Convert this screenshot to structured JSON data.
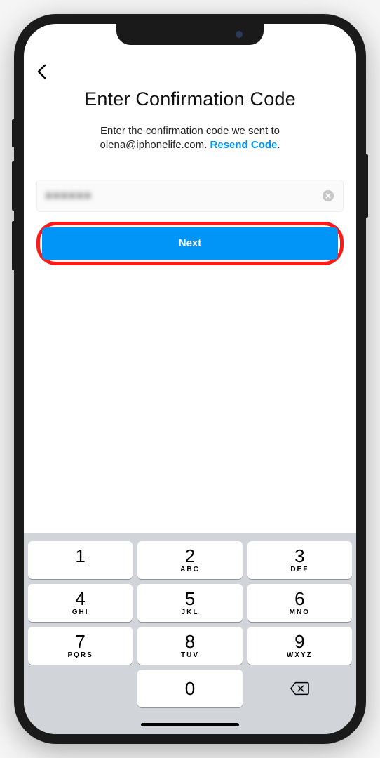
{
  "header": {
    "title": "Enter Confirmation Code",
    "subtitle_prefix": "Enter the confirmation code we sent to ",
    "email": "olena@iphonelife.com",
    "subtitle_separator": ". ",
    "resend_link": "Resend Code",
    "subtitle_suffix": "."
  },
  "form": {
    "code_value": "●●●●●●",
    "next_label": "Next"
  },
  "keyboard": {
    "keys": [
      {
        "digit": "1",
        "letters": ""
      },
      {
        "digit": "2",
        "letters": "ABC"
      },
      {
        "digit": "3",
        "letters": "DEF"
      },
      {
        "digit": "4",
        "letters": "GHI"
      },
      {
        "digit": "5",
        "letters": "JKL"
      },
      {
        "digit": "6",
        "letters": "MNO"
      },
      {
        "digit": "7",
        "letters": "PQRS"
      },
      {
        "digit": "8",
        "letters": "TUV"
      },
      {
        "digit": "9",
        "letters": "WXYZ"
      },
      {
        "digit": "",
        "letters": ""
      },
      {
        "digit": "0",
        "letters": ""
      },
      {
        "digit": "⌫",
        "letters": ""
      }
    ]
  },
  "colors": {
    "accent": "#0095f6",
    "highlight": "#ff1a1a"
  }
}
